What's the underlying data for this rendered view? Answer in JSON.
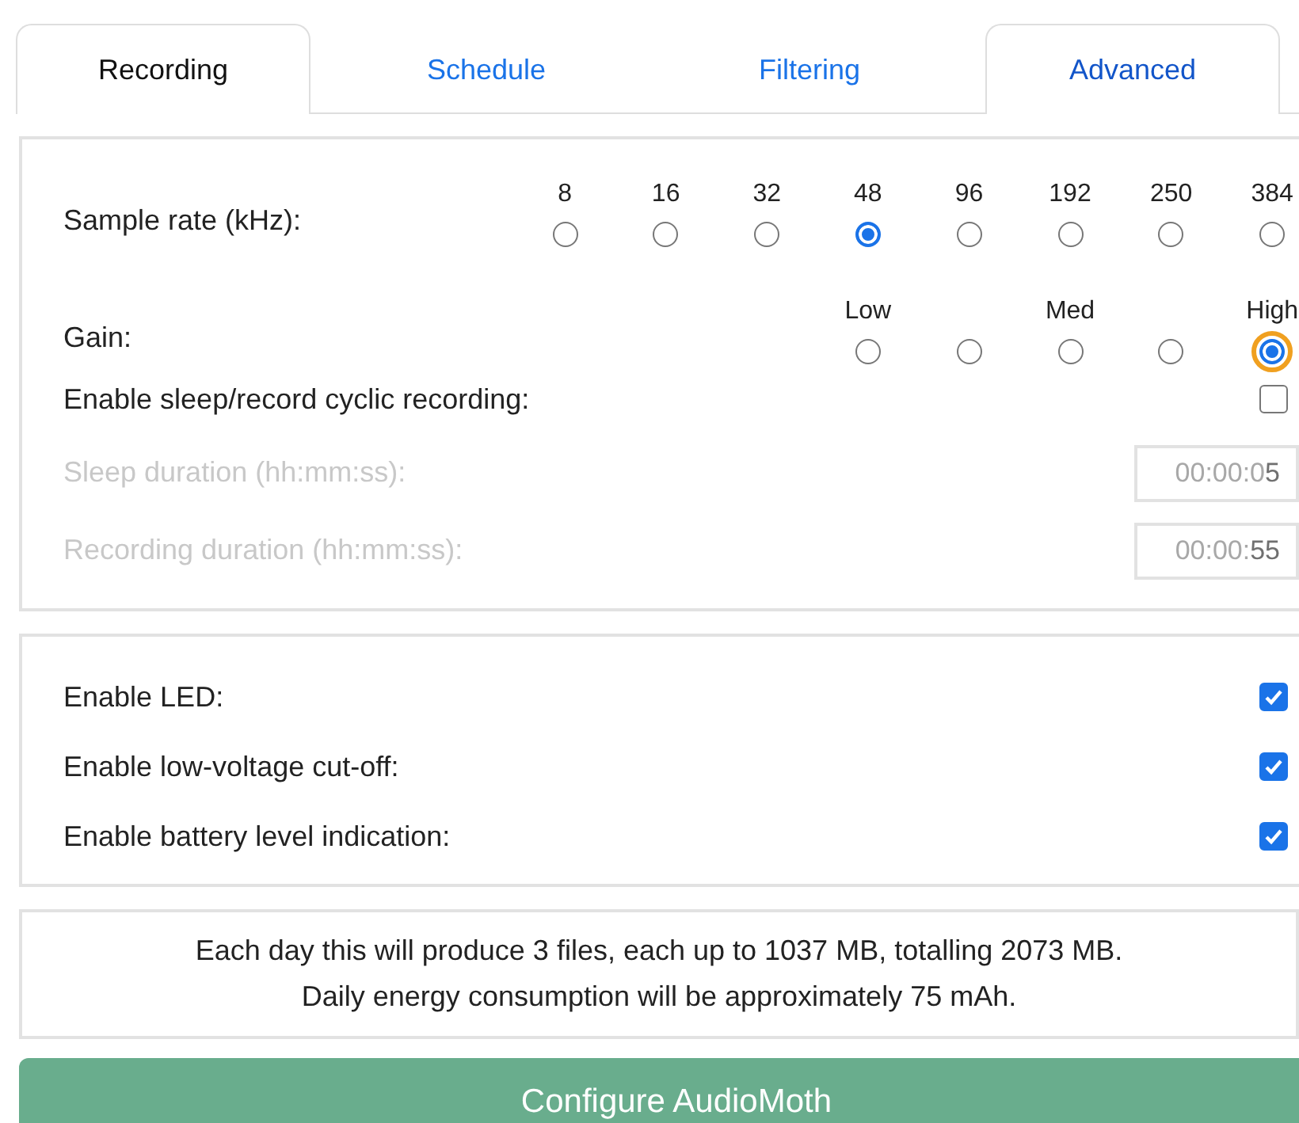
{
  "tabs": [
    {
      "label": "Recording",
      "selected": true,
      "outlined": true
    },
    {
      "label": "Schedule",
      "selected": false,
      "outlined": false
    },
    {
      "label": "Filtering",
      "selected": false,
      "outlined": false
    },
    {
      "label": "Advanced",
      "selected": false,
      "outlined": true
    }
  ],
  "sample_rate": {
    "label": "Sample rate (kHz):",
    "options": [
      {
        "label": "8",
        "selected": false
      },
      {
        "label": "16",
        "selected": false
      },
      {
        "label": "32",
        "selected": false
      },
      {
        "label": "48",
        "selected": true
      },
      {
        "label": "96",
        "selected": false
      },
      {
        "label": "192",
        "selected": false
      },
      {
        "label": "250",
        "selected": false
      },
      {
        "label": "384",
        "selected": false
      }
    ]
  },
  "gain": {
    "label": "Gain:",
    "options": [
      {
        "label": "Low",
        "selected": false,
        "focused": false
      },
      {
        "selected": false,
        "focused": false
      },
      {
        "label": "Med",
        "selected": false,
        "focused": false
      },
      {
        "selected": false,
        "focused": false
      },
      {
        "label": "High",
        "selected": true,
        "focused": true
      }
    ]
  },
  "cyclic": {
    "label": "Enable sleep/record cyclic recording:",
    "checked": false
  },
  "durations": [
    {
      "label": "Sleep duration (hh:mm:ss):",
      "dim_part": "00:00:0",
      "bright_part": "5",
      "disabled": true
    },
    {
      "label": "Recording duration (hh:mm:ss):",
      "dim_part": "00:00:",
      "bright_part": "55",
      "disabled": true
    }
  ],
  "options": [
    {
      "label": "Enable LED:",
      "checked": true
    },
    {
      "label": "Enable low-voltage cut-off:",
      "checked": true
    },
    {
      "label": "Enable battery level indication:",
      "checked": true
    }
  ],
  "summary": [
    "Each day this will produce 3 files, each up to 1037 MB, totalling 2073 MB.",
    "Daily energy consumption will be approximately 75 mAh."
  ],
  "configure_button": "Configure AudioMoth"
}
